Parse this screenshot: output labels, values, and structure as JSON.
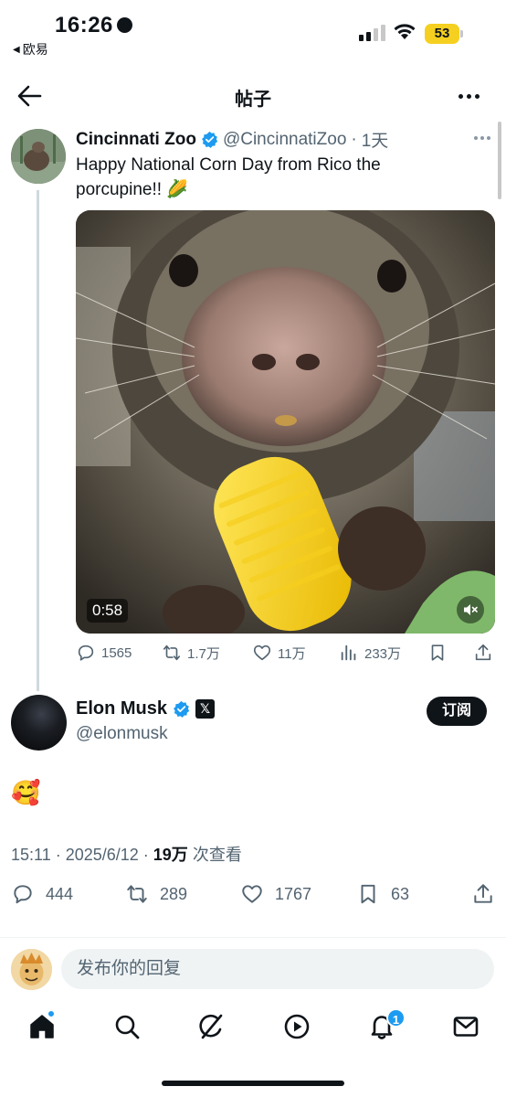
{
  "status_bar": {
    "time": "16:26",
    "back_app": "欧易",
    "battery": "53",
    "battery_color": "#f5d020"
  },
  "header": {
    "title": "帖子",
    "back_icon": "arrow-left-icon",
    "more_icon": "more-horizontal-icon"
  },
  "quoted_tweet": {
    "author_name": "Cincinnati Zoo",
    "handle": "@CincinnatiZoo",
    "separator": "·",
    "time_ago": "1天",
    "text": "Happy National Corn Day from Rico the porcupine!! 🌽",
    "video_duration": "0:58",
    "stats": {
      "replies": "1565",
      "reposts": "1.7万",
      "likes": "11万",
      "views": "233万"
    }
  },
  "main_tweet": {
    "author_name": "Elon Musk",
    "handle": "@elonmusk",
    "subscribe_label": "订阅",
    "body": "🥰",
    "timestamp": "15:11 · 2025/6/12 · ",
    "views_count": "19万",
    "views_label": " 次查看",
    "stats": {
      "replies": "444",
      "reposts": "289",
      "likes": "1767",
      "bookmarks": "63"
    }
  },
  "reply": {
    "placeholder": "发布你的回复"
  },
  "bottom_nav": {
    "notification_count": "1",
    "items": [
      "home-icon",
      "search-icon",
      "grok-icon",
      "video-icon",
      "notifications-icon",
      "messages-icon"
    ]
  },
  "colors": {
    "accent": "#1d9bf0",
    "text": "#0f1419",
    "secondary": "#536471"
  }
}
